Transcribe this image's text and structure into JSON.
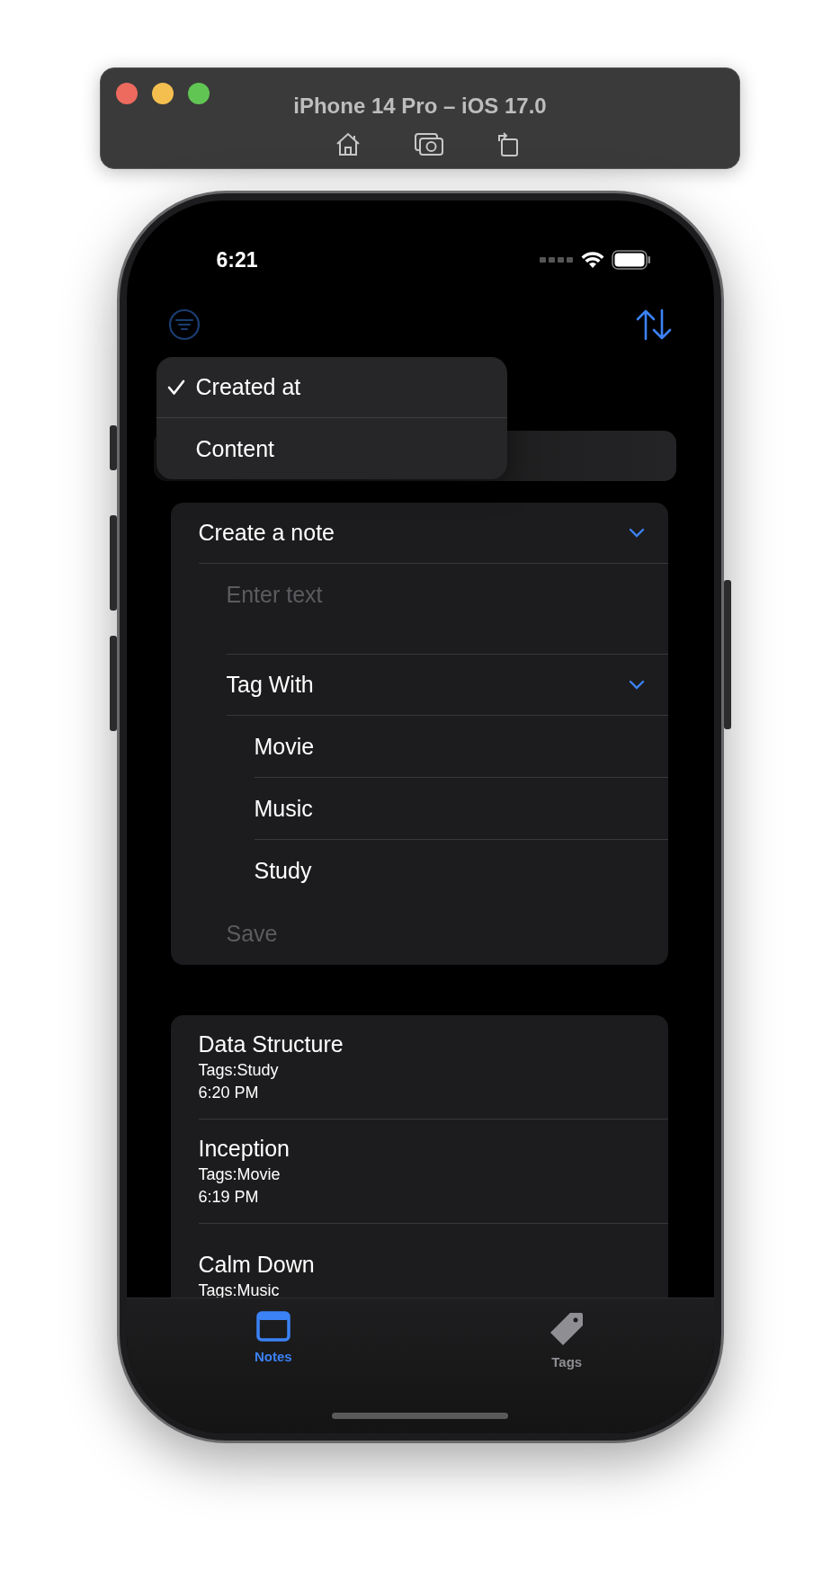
{
  "simulator": {
    "title": "iPhone 14 Pro – iOS 17.0"
  },
  "status_bar": {
    "time": "6:21"
  },
  "sort_menu": {
    "items": [
      {
        "label": "Created at",
        "selected": true
      },
      {
        "label": "Content",
        "selected": false
      }
    ]
  },
  "create_note": {
    "title": "Create a note",
    "expanded": true,
    "text_field": {
      "placeholder": "Enter text"
    },
    "tag_section": {
      "title": "Tag With",
      "expanded": true,
      "tags": [
        {
          "label": "Movie",
          "selected": false
        },
        {
          "label": "Music",
          "selected": false
        },
        {
          "label": "Study",
          "selected": false
        }
      ]
    },
    "save": {
      "label": "Save",
      "disabled": true
    }
  },
  "notes": [
    {
      "title": "Data Structure",
      "tags": "Tags:Study",
      "time": "6:20 PM"
    },
    {
      "title": "Inception",
      "tags": "Tags:Movie",
      "time": "6:19 PM"
    },
    {
      "title": "Calm Down",
      "tags": "Tags:Music"
    }
  ],
  "tab_bar": {
    "tabs": [
      {
        "label": "Notes",
        "selected": true,
        "kind": "window"
      },
      {
        "label": "Tags",
        "selected": false,
        "kind": "tag"
      }
    ]
  }
}
